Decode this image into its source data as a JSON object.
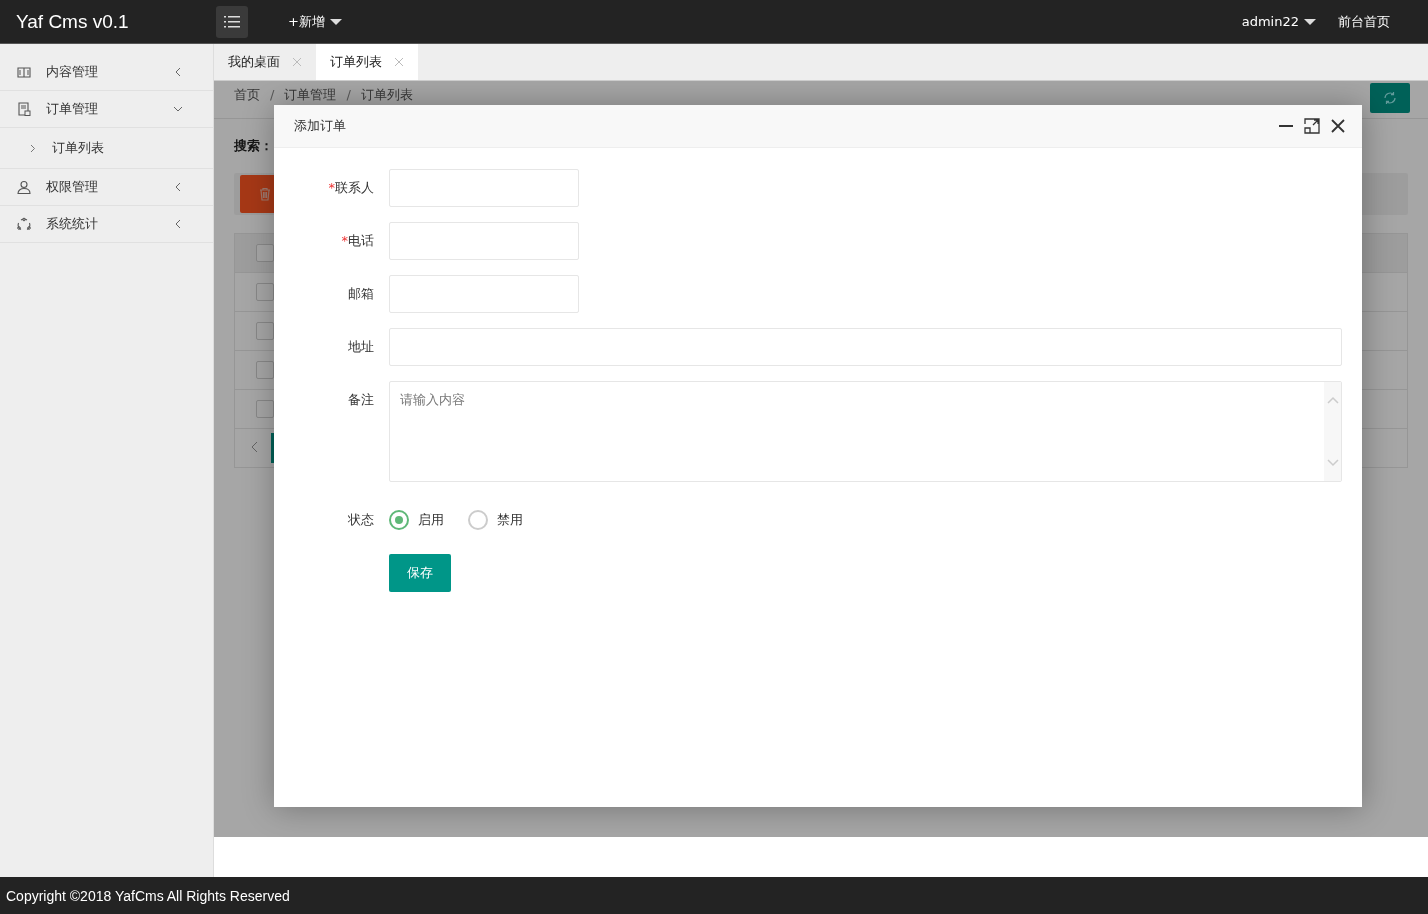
{
  "header": {
    "logo": "Yaf Cms v0.1",
    "new_menu": "+新增",
    "user": "admin22",
    "front_link": "前台首页"
  },
  "sidebar": {
    "items": [
      {
        "label": "内容管理",
        "expanded": false
      },
      {
        "label": "订单管理",
        "expanded": true,
        "children": [
          {
            "label": "订单列表"
          }
        ]
      },
      {
        "label": "权限管理",
        "expanded": false
      },
      {
        "label": "系统统计",
        "expanded": false
      }
    ]
  },
  "tabs": [
    {
      "label": "我的桌面",
      "selected": false
    },
    {
      "label": "订单列表",
      "selected": true
    }
  ],
  "breadcrumb": [
    {
      "kind": "link",
      "text": "首页"
    },
    {
      "kind": "separator",
      "text": "/"
    },
    {
      "kind": "link",
      "text": "订单管理"
    },
    {
      "kind": "separator",
      "text": "/"
    },
    {
      "kind": "link",
      "text": "订单列表"
    }
  ],
  "search_label": "搜索：",
  "table": {
    "header_checked": false,
    "rows": [
      {
        "checked": false
      },
      {
        "checked": false
      },
      {
        "checked": false
      },
      {
        "checked": false
      }
    ]
  },
  "dialog": {
    "title": "添加订单",
    "fields": [
      {
        "label": "联系人",
        "required_mark": "*",
        "kind": "short"
      },
      {
        "label": "电话",
        "required_mark": "*",
        "kind": "short"
      },
      {
        "label": "邮箱",
        "kind": "short"
      },
      {
        "label": "地址",
        "kind": "wide"
      },
      {
        "label": "备注",
        "kind": "textarea",
        "placeholder": "请输入内容"
      }
    ],
    "status": {
      "label": "状态",
      "options": [
        {
          "label": "启用",
          "selected": true
        },
        {
          "label": "禁用",
          "selected": false
        }
      ]
    },
    "save": "保存"
  },
  "footer": "Copyright ©2018 YafCms All Rights Reserved"
}
